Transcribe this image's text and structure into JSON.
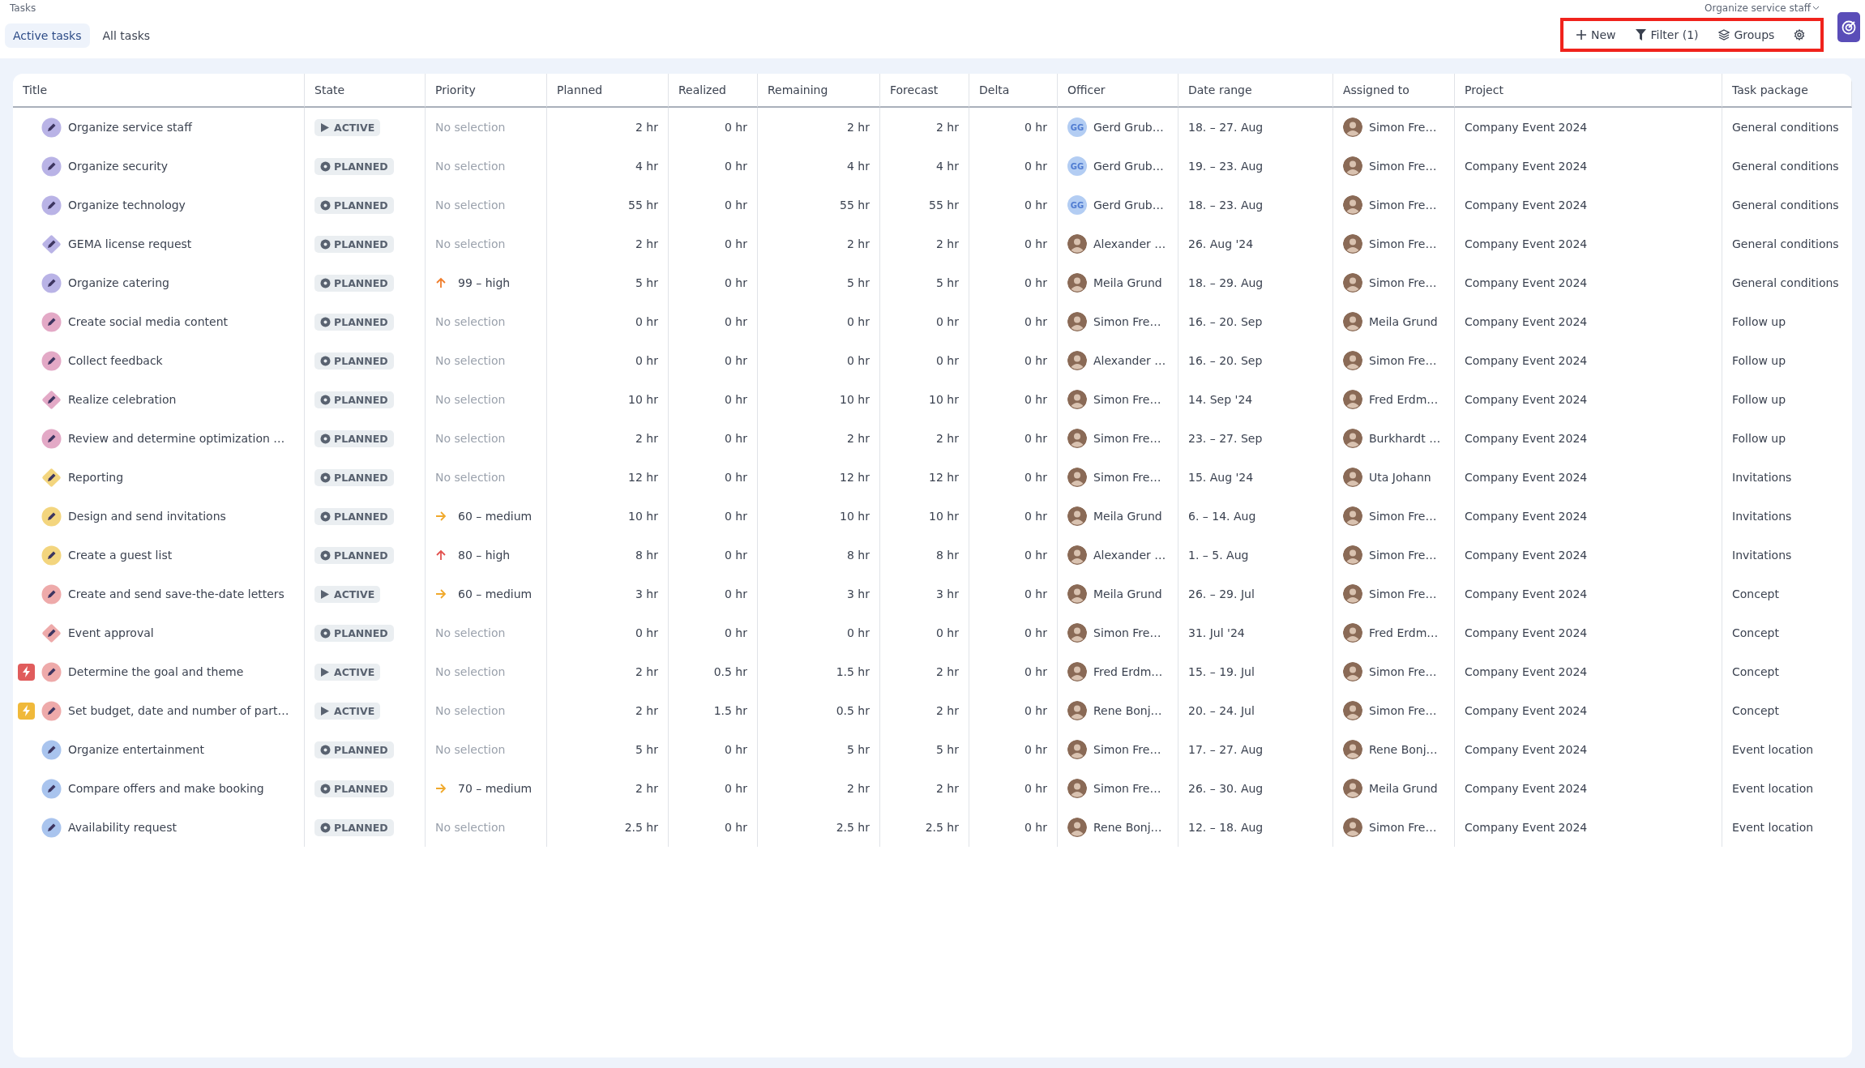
{
  "header": {
    "title": "Tasks",
    "context": "Organize service staff"
  },
  "tabs": [
    {
      "label": "Active tasks",
      "selected": true
    },
    {
      "label": "All tasks",
      "selected": false
    }
  ],
  "toolbar": [
    {
      "label": "New",
      "kind": "new"
    },
    {
      "label": "Filter (1)",
      "kind": "filter"
    },
    {
      "label": "Groups",
      "kind": "groups"
    },
    {
      "kind": "settings"
    }
  ],
  "table": {
    "columns": [
      "Title",
      "State",
      "Priority",
      "Planned",
      "Realized",
      "Remaining",
      "Forecast",
      "Delta",
      "Officer",
      "Date range",
      "Assigned to",
      "Project",
      "Task package"
    ],
    "rows": [
      {
        "title": "Organize service staff",
        "icon": {
          "kind": "circle",
          "color": "#b9b3e6"
        },
        "state": {
          "label": "ACTIVE",
          "kind": "active"
        },
        "priority": {
          "text": "No selection",
          "kind": "none"
        },
        "planned": "2 hr",
        "realized": "0 hr",
        "remaining": "2 hr",
        "forecast": "2 hr",
        "delta": "0 hr",
        "officer": {
          "name": "Gerd Grub…",
          "kind": "initials",
          "initials": "GG"
        },
        "date_range": "18. – 27. Aug",
        "assigned_to": {
          "name": "Simon Fre…",
          "kind": "photo"
        },
        "project": "Company Event 2024",
        "task_package": "General conditions"
      },
      {
        "title": "Organize security",
        "icon": {
          "kind": "circle",
          "color": "#b9b3e6"
        },
        "state": {
          "label": "PLANNED",
          "kind": "planned"
        },
        "priority": {
          "text": "No selection",
          "kind": "none"
        },
        "planned": "4 hr",
        "realized": "0 hr",
        "remaining": "4 hr",
        "forecast": "4 hr",
        "delta": "0 hr",
        "officer": {
          "name": "Gerd Grub…",
          "kind": "initials",
          "initials": "GG"
        },
        "date_range": "19. – 23. Aug",
        "assigned_to": {
          "name": "Simon Fre…",
          "kind": "photo"
        },
        "project": "Company Event 2024",
        "task_package": "General conditions"
      },
      {
        "title": "Organize technology",
        "icon": {
          "kind": "circle",
          "color": "#b9b3e6"
        },
        "state": {
          "label": "PLANNED",
          "kind": "planned"
        },
        "priority": {
          "text": "No selection",
          "kind": "none"
        },
        "planned": "55 hr",
        "realized": "0 hr",
        "remaining": "55 hr",
        "forecast": "55 hr",
        "delta": "0 hr",
        "officer": {
          "name": "Gerd Grub…",
          "kind": "initials",
          "initials": "GG"
        },
        "date_range": "18. – 23. Aug",
        "assigned_to": {
          "name": "Simon Fre…",
          "kind": "photo"
        },
        "project": "Company Event 2024",
        "task_package": "General conditions"
      },
      {
        "title": "GEMA license request",
        "icon": {
          "kind": "diamond",
          "color": "#b9b3e6"
        },
        "state": {
          "label": "PLANNED",
          "kind": "planned"
        },
        "priority": {
          "text": "No selection",
          "kind": "none"
        },
        "planned": "2 hr",
        "realized": "0 hr",
        "remaining": "2 hr",
        "forecast": "2 hr",
        "delta": "0 hr",
        "officer": {
          "name": "Alexander …",
          "kind": "photo"
        },
        "date_range": "26. Aug '24",
        "assigned_to": {
          "name": "Simon Fre…",
          "kind": "photo"
        },
        "project": "Company Event 2024",
        "task_package": "General conditions"
      },
      {
        "title": "Organize catering",
        "icon": {
          "kind": "circle",
          "color": "#b9b3e6"
        },
        "state": {
          "label": "PLANNED",
          "kind": "planned"
        },
        "priority": {
          "text": "99 – high",
          "kind": "up",
          "color": "#f07d2c"
        },
        "planned": "5 hr",
        "realized": "0 hr",
        "remaining": "5 hr",
        "forecast": "5 hr",
        "delta": "0 hr",
        "officer": {
          "name": "Meila Grund",
          "kind": "photo"
        },
        "date_range": "18. – 29. Aug",
        "assigned_to": {
          "name": "Simon Fre…",
          "kind": "photo"
        },
        "project": "Company Event 2024",
        "task_package": "General conditions"
      },
      {
        "title": "Create social media content",
        "icon": {
          "kind": "circle",
          "color": "#e3a9c6"
        },
        "state": {
          "label": "PLANNED",
          "kind": "planned"
        },
        "priority": {
          "text": "No selection",
          "kind": "none"
        },
        "planned": "0 hr",
        "realized": "0 hr",
        "remaining": "0 hr",
        "forecast": "0 hr",
        "delta": "0 hr",
        "officer": {
          "name": "Simon Fre…",
          "kind": "photo"
        },
        "date_range": "16. – 20. Sep",
        "assigned_to": {
          "name": "Meila Grund",
          "kind": "photo"
        },
        "project": "Company Event 2024",
        "task_package": "Follow up"
      },
      {
        "title": "Collect feedback",
        "icon": {
          "kind": "circle",
          "color": "#e3a9c6"
        },
        "state": {
          "label": "PLANNED",
          "kind": "planned"
        },
        "priority": {
          "text": "No selection",
          "kind": "none"
        },
        "planned": "0 hr",
        "realized": "0 hr",
        "remaining": "0 hr",
        "forecast": "0 hr",
        "delta": "0 hr",
        "officer": {
          "name": "Alexander …",
          "kind": "photo"
        },
        "date_range": "16. – 20. Sep",
        "assigned_to": {
          "name": "Simon Fre…",
          "kind": "photo"
        },
        "project": "Company Event 2024",
        "task_package": "Follow up"
      },
      {
        "title": "Realize celebration",
        "icon": {
          "kind": "diamond",
          "color": "#e3a9c6"
        },
        "state": {
          "label": "PLANNED",
          "kind": "planned"
        },
        "priority": {
          "text": "No selection",
          "kind": "none"
        },
        "planned": "10 hr",
        "realized": "0 hr",
        "remaining": "10 hr",
        "forecast": "10 hr",
        "delta": "0 hr",
        "officer": {
          "name": "Simon Fre…",
          "kind": "photo"
        },
        "date_range": "14. Sep '24",
        "assigned_to": {
          "name": "Fred Erdm…",
          "kind": "photo"
        },
        "project": "Company Event 2024",
        "task_package": "Follow up"
      },
      {
        "title": "Review and determine optimization …",
        "icon": {
          "kind": "circle",
          "color": "#e3a9c6"
        },
        "state": {
          "label": "PLANNED",
          "kind": "planned"
        },
        "priority": {
          "text": "No selection",
          "kind": "none"
        },
        "planned": "2 hr",
        "realized": "0 hr",
        "remaining": "2 hr",
        "forecast": "2 hr",
        "delta": "0 hr",
        "officer": {
          "name": "Simon Fre…",
          "kind": "photo"
        },
        "date_range": "23. – 27. Sep",
        "assigned_to": {
          "name": "Burkhardt …",
          "kind": "photo"
        },
        "project": "Company Event 2024",
        "task_package": "Follow up"
      },
      {
        "title": "Reporting",
        "icon": {
          "kind": "diamond",
          "color": "#f3d57e"
        },
        "state": {
          "label": "PLANNED",
          "kind": "planned"
        },
        "priority": {
          "text": "No selection",
          "kind": "none"
        },
        "planned": "12 hr",
        "realized": "0 hr",
        "remaining": "12 hr",
        "forecast": "12 hr",
        "delta": "0 hr",
        "officer": {
          "name": "Simon Fre…",
          "kind": "photo"
        },
        "date_range": "15. Aug '24",
        "assigned_to": {
          "name": "Uta Johann",
          "kind": "photo"
        },
        "project": "Company Event 2024",
        "task_package": "Invitations"
      },
      {
        "title": "Design and send invitations",
        "icon": {
          "kind": "circle",
          "color": "#f3d57e"
        },
        "state": {
          "label": "PLANNED",
          "kind": "planned"
        },
        "priority": {
          "text": "60 – medium",
          "kind": "right",
          "color": "#f0a92c"
        },
        "planned": "10 hr",
        "realized": "0 hr",
        "remaining": "10 hr",
        "forecast": "10 hr",
        "delta": "0 hr",
        "officer": {
          "name": "Meila Grund",
          "kind": "photo"
        },
        "date_range": "6. – 14. Aug",
        "assigned_to": {
          "name": "Simon Fre…",
          "kind": "photo"
        },
        "project": "Company Event 2024",
        "task_package": "Invitations"
      },
      {
        "title": "Create a guest list",
        "icon": {
          "kind": "circle",
          "color": "#f3d57e"
        },
        "state": {
          "label": "PLANNED",
          "kind": "planned"
        },
        "priority": {
          "text": "80 – high",
          "kind": "up",
          "color": "#e2524f"
        },
        "planned": "8 hr",
        "realized": "0 hr",
        "remaining": "8 hr",
        "forecast": "8 hr",
        "delta": "0 hr",
        "officer": {
          "name": "Alexander …",
          "kind": "photo"
        },
        "date_range": "1. – 5. Aug",
        "assigned_to": {
          "name": "Simon Fre…",
          "kind": "photo"
        },
        "project": "Company Event 2024",
        "task_package": "Invitations"
      },
      {
        "title": "Create and send save-the-date letters",
        "icon": {
          "kind": "circle",
          "color": "#eeaaaa"
        },
        "state": {
          "label": "ACTIVE",
          "kind": "active"
        },
        "priority": {
          "text": "60 – medium",
          "kind": "right",
          "color": "#f0a92c"
        },
        "planned": "3 hr",
        "realized": "0 hr",
        "remaining": "3 hr",
        "forecast": "3 hr",
        "delta": "0 hr",
        "officer": {
          "name": "Meila Grund",
          "kind": "photo"
        },
        "date_range": "26. – 29. Jul",
        "assigned_to": {
          "name": "Simon Fre…",
          "kind": "photo"
        },
        "project": "Company Event 2024",
        "task_package": "Concept"
      },
      {
        "title": "Event approval",
        "icon": {
          "kind": "diamond",
          "color": "#eeaaaa"
        },
        "state": {
          "label": "PLANNED",
          "kind": "planned"
        },
        "priority": {
          "text": "No selection",
          "kind": "none"
        },
        "planned": "0 hr",
        "realized": "0 hr",
        "remaining": "0 hr",
        "forecast": "0 hr",
        "delta": "0 hr",
        "officer": {
          "name": "Simon Fre…",
          "kind": "photo"
        },
        "date_range": "31. Jul '24",
        "assigned_to": {
          "name": "Fred Erdm…",
          "kind": "photo"
        },
        "project": "Company Event 2024",
        "task_package": "Concept"
      },
      {
        "title": "Determine the goal and theme",
        "flag": {
          "color": "#e05c5c"
        },
        "icon": {
          "kind": "circle",
          "color": "#eeaaaa"
        },
        "state": {
          "label": "ACTIVE",
          "kind": "active"
        },
        "priority": {
          "text": "No selection",
          "kind": "none"
        },
        "planned": "2 hr",
        "realized": "0.5 hr",
        "remaining": "1.5 hr",
        "forecast": "2 hr",
        "delta": "0 hr",
        "officer": {
          "name": "Fred Erdm…",
          "kind": "photo"
        },
        "date_range": "15. – 19. Jul",
        "assigned_to": {
          "name": "Simon Fre…",
          "kind": "photo"
        },
        "project": "Company Event 2024",
        "task_package": "Concept"
      },
      {
        "title": "Set budget, date and number of part…",
        "flag": {
          "color": "#f0b93a"
        },
        "icon": {
          "kind": "circle",
          "color": "#eeaaaa"
        },
        "state": {
          "label": "ACTIVE",
          "kind": "active"
        },
        "priority": {
          "text": "No selection",
          "kind": "none"
        },
        "planned": "2 hr",
        "realized": "1.5 hr",
        "remaining": "0.5 hr",
        "forecast": "2 hr",
        "delta": "0 hr",
        "officer": {
          "name": "Rene Bonj…",
          "kind": "photo"
        },
        "date_range": "20. – 24. Jul",
        "assigned_to": {
          "name": "Simon Fre…",
          "kind": "photo"
        },
        "project": "Company Event 2024",
        "task_package": "Concept"
      },
      {
        "title": "Organize entertainment",
        "icon": {
          "kind": "circle",
          "color": "#a9c4ee"
        },
        "state": {
          "label": "PLANNED",
          "kind": "planned"
        },
        "priority": {
          "text": "No selection",
          "kind": "none"
        },
        "planned": "5 hr",
        "realized": "0 hr",
        "remaining": "5 hr",
        "forecast": "5 hr",
        "delta": "0 hr",
        "officer": {
          "name": "Simon Fre…",
          "kind": "photo"
        },
        "date_range": "17. – 27. Aug",
        "assigned_to": {
          "name": "Rene Bonj…",
          "kind": "photo"
        },
        "project": "Company Event 2024",
        "task_package": "Event location"
      },
      {
        "title": "Compare offers and make booking",
        "icon": {
          "kind": "circle",
          "color": "#a9c4ee"
        },
        "state": {
          "label": "PLANNED",
          "kind": "planned"
        },
        "priority": {
          "text": "70 – medium",
          "kind": "right",
          "color": "#f0a92c"
        },
        "planned": "2 hr",
        "realized": "0 hr",
        "remaining": "2 hr",
        "forecast": "2 hr",
        "delta": "0 hr",
        "officer": {
          "name": "Simon Fre…",
          "kind": "photo"
        },
        "date_range": "26. – 30. Aug",
        "assigned_to": {
          "name": "Meila Grund",
          "kind": "photo"
        },
        "project": "Company Event 2024",
        "task_package": "Event location"
      },
      {
        "title": "Availability request",
        "icon": {
          "kind": "circle",
          "color": "#a9c4ee"
        },
        "state": {
          "label": "PLANNED",
          "kind": "planned"
        },
        "priority": {
          "text": "No selection",
          "kind": "none"
        },
        "planned": "2.5 hr",
        "realized": "0 hr",
        "remaining": "2.5 hr",
        "forecast": "2.5 hr",
        "delta": "0 hr",
        "officer": {
          "name": "Rene Bonj…",
          "kind": "photo"
        },
        "date_range": "12. – 18. Aug",
        "assigned_to": {
          "name": "Simon Fre…",
          "kind": "photo"
        },
        "project": "Company Event 2024",
        "task_package": "Event location"
      }
    ]
  }
}
